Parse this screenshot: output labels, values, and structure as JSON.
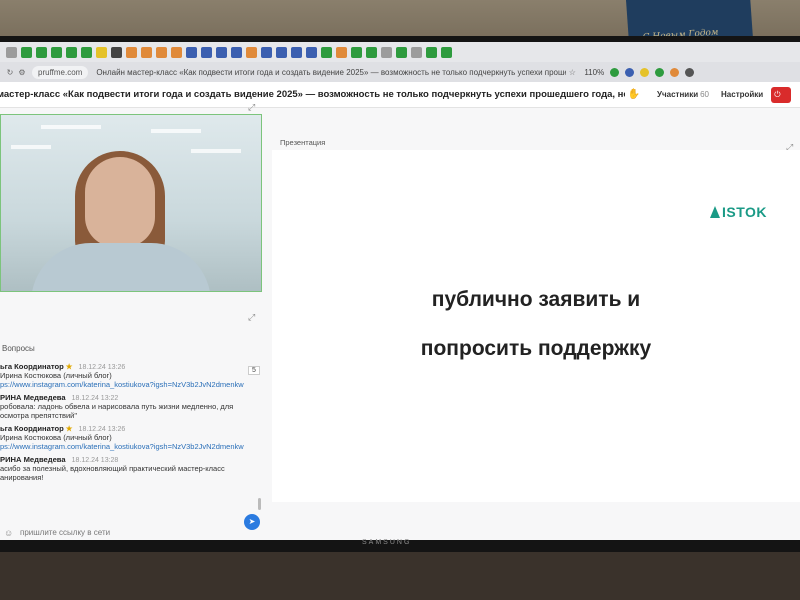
{
  "browser": {
    "url": "pruffme.com",
    "page_title": "Онлайн мастер-класс «Как подвести итоги года и создать видение 2025» — возможность не только подчеркнуть успехи прошедшего года, но...",
    "zoom": "110%"
  },
  "header": {
    "event_title": "мастер-класс «Как подвести итоги года и создать видение 2025» — возможность не только подчеркнуть успехи прошедшего года, но и за...",
    "participants_label": "Участники",
    "participants_count": "60",
    "settings_label": "Настройки"
  },
  "questions": {
    "title": "Вопросы",
    "counter": "5",
    "messages": [
      {
        "author": "ьга Координатор",
        "time": "18.12.24 13:26",
        "lines": [
          "Ирина Костюкова (личный блог)",
          "ps://www.instagram.com/katerina_kostiukova?igsh=NzV3b2JvN2dmenkw"
        ]
      },
      {
        "author": "РИНА Медведева",
        "time": "18.12.24 13:22",
        "lines": [
          "робовала: ладонь обвела и нарисовала путь жизни медленно, для",
          "осмотра препятствий\""
        ]
      },
      {
        "author": "ьга Координатор",
        "time": "18.12.24 13:26",
        "lines": [
          "Ирина Костюкова (личный блог)",
          "ps://www.instagram.com/katerina_kostiukova?igsh=NzV3b2JvN2dmenkw"
        ]
      },
      {
        "author": "РИНА Медведева",
        "time": "18.12.24 13:28",
        "lines": [
          "асибо за полезный, вдохновляющий практический мастер-класс",
          "анирования!"
        ]
      }
    ],
    "input_placeholder": "пришлите ссылку в сети"
  },
  "presentation": {
    "title": "Презентация",
    "logo_text": "ISTOK",
    "slide_line1": "публично заявить и",
    "slide_line2": "попросить поддержку"
  },
  "monitor_brand": "SAMSUNG",
  "card_text": "С Новым Годом"
}
